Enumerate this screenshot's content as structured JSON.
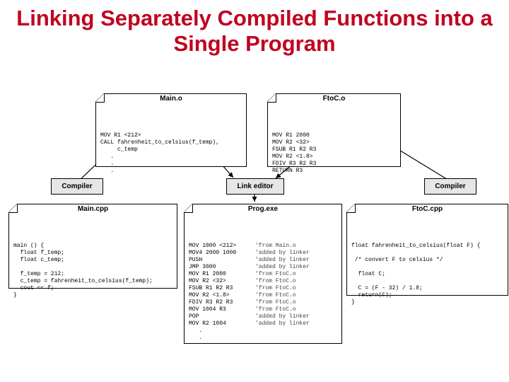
{
  "title": "Linking Separately Compiled Functions into a Single Program",
  "docs": {
    "main_o": {
      "label": "Main.o",
      "body": "MOV R1 <212>\nCALL fahrenheit_to_celsius(f_temp),\n     c_temp\n   .\n   .\n   ."
    },
    "ftoc_o": {
      "label": "FtoC.o",
      "body": "MOV R1 2000\nMOV R2 <32>\nFSUB R1 R2 R3\nMOV R2 <1.8>\nFDIV R3 R2 R3\nRETURN R3"
    },
    "main_cpp": {
      "label": "Main.cpp",
      "body": "main () {\n  float f_temp;\n  float c_temp;\n\n  f_temp = 212;\n  c_temp = fahrenheit_to_celsius(f_temp);\n  cout << f;\n}"
    },
    "prog_exe": {
      "label": "Prog.exe",
      "left": [
        "MOV 1000 <212>",
        "MOV4 2000 1000",
        "PUSH",
        "JMP 3000",
        "MOV R1 2000",
        "MOV R2 <32>",
        "FSUB R1 R2 R3",
        "MOV R2 <1.8>",
        "FDIV R3 R2 R3",
        "MOV 1004 R3",
        "POP",
        "MOV R2 1004",
        "   .",
        "   ."
      ],
      "right": [
        "'from Main.o",
        "'added by linker",
        "'added by linker",
        "'added by linker",
        "'from FtoC.o",
        "'from FtoC.o",
        "'from FtoC.o",
        "'from FtoC.o",
        "'from FtoC.o",
        "'from FtoC.o",
        "'added by linker",
        "'added by linker",
        "",
        ""
      ]
    },
    "ftoc_cpp": {
      "label": "FtoC.cpp",
      "body": "float fahrenheit_to_celsius(float F) {\n\n /* convert F to celsius */\n\n  float C;\n\n  C = (F - 32) / 1.8;\n  return(C);\n}"
    }
  },
  "procs": {
    "compiler_l": "Compiler",
    "linker": "Link editor",
    "compiler_r": "Compiler"
  }
}
